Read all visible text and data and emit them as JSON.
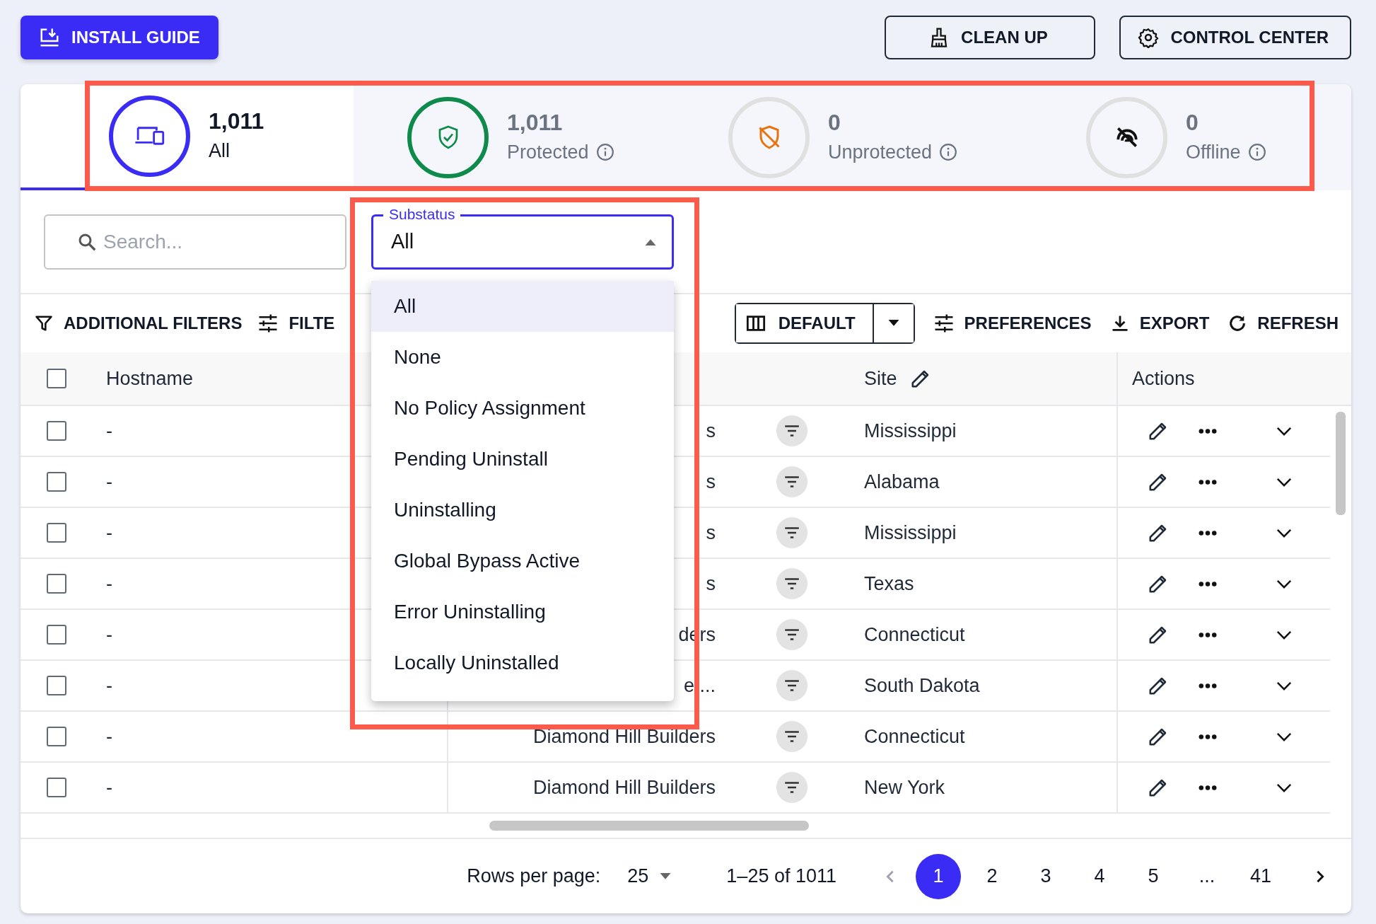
{
  "header": {
    "install_button": {
      "label": "INSTALL GUIDE"
    },
    "cleanup_button": {
      "label": "CLEAN UP"
    },
    "control_center_button": {
      "label": "CONTROL CENTER"
    }
  },
  "stats": [
    {
      "kind": "all",
      "count": "1,011",
      "label": "All",
      "selected": true,
      "info": false,
      "color": "#3a2cf5"
    },
    {
      "kind": "protected",
      "count": "1,011",
      "label": "Protected",
      "selected": false,
      "info": true,
      "color": "#0e8a4a"
    },
    {
      "kind": "unprotected",
      "count": "0",
      "label": "Unprotected",
      "selected": false,
      "info": true,
      "color": "#e0e0e0"
    },
    {
      "kind": "offline",
      "count": "0",
      "label": "Offline",
      "selected": false,
      "info": true,
      "color": "#e0e0e0"
    }
  ],
  "search": {
    "placeholder": "Search..."
  },
  "substatus": {
    "label": "Substatus",
    "value": "All",
    "expanded": true,
    "options": [
      {
        "label": "All",
        "selected": true
      },
      {
        "label": "None",
        "selected": false
      },
      {
        "label": "No Policy Assignment",
        "selected": false
      },
      {
        "label": "Pending Uninstall",
        "selected": false
      },
      {
        "label": "Uninstalling",
        "selected": false
      },
      {
        "label": "Global Bypass Active",
        "selected": false
      },
      {
        "label": "Error Uninstalling",
        "selected": false
      },
      {
        "label": "Locally Uninstalled",
        "selected": false
      }
    ]
  },
  "toolbar": {
    "additional_filters": "ADDITIONAL FILTERS",
    "filters": "FILTE",
    "view": "DEFAULT",
    "preferences": "PREFERENCES",
    "export": "EXPORT",
    "refresh": "REFRESH"
  },
  "table": {
    "select_all_checked": false,
    "columns": {
      "hostname": "Hostname",
      "site": "Site",
      "actions": "Actions"
    },
    "rows": [
      {
        "checked": false,
        "hostname": "-",
        "column_2": "s",
        "site": "Mississippi"
      },
      {
        "checked": false,
        "hostname": "-",
        "column_2": "s",
        "site": "Alabama"
      },
      {
        "checked": false,
        "hostname": "-",
        "column_2": "s",
        "site": "Mississippi"
      },
      {
        "checked": false,
        "hostname": "-",
        "column_2": "s",
        "site": "Texas"
      },
      {
        "checked": false,
        "hostname": "-",
        "column_2": "ders",
        "site": "Connecticut"
      },
      {
        "checked": false,
        "hostname": "-",
        "column_2": "e ...",
        "site": "South Dakota"
      },
      {
        "checked": false,
        "hostname": "-",
        "column_2": "Diamond Hill Builders",
        "site": "Connecticut"
      },
      {
        "checked": false,
        "hostname": "-",
        "column_2": "Diamond Hill Builders",
        "site": "New York"
      }
    ]
  },
  "footer": {
    "rows_per_page_label": "Rows per page:",
    "rows_per_page": "25",
    "range": "1–25 of 1011",
    "pages": [
      {
        "label": "1",
        "selected": true
      },
      {
        "label": "2",
        "selected": false
      },
      {
        "label": "3",
        "selected": false
      },
      {
        "label": "4",
        "selected": false
      },
      {
        "label": "5",
        "selected": false
      },
      {
        "label": "...",
        "selected": false
      },
      {
        "label": "41",
        "selected": false
      }
    ]
  },
  "annotations": {
    "highlight_stats": true,
    "highlight_substatus": true
  }
}
